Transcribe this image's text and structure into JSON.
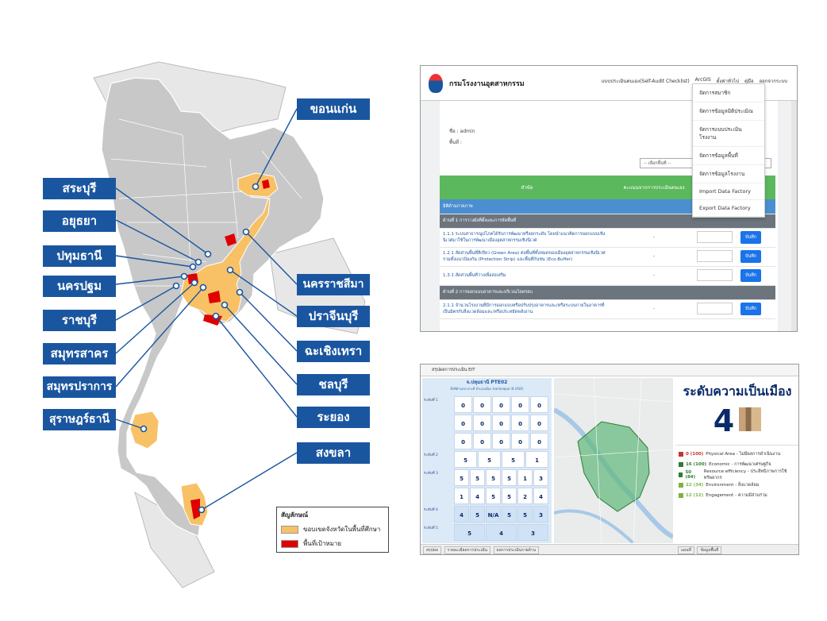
{
  "map": {
    "labels_left": [
      "สระบุรี",
      "อยุธยา",
      "ปทุมธานี",
      "นครปฐม",
      "ราชบุรี",
      "สมุทรสาคร",
      "สมุทรปราการ",
      "สุราษฎร์ธานี"
    ],
    "labels_right": [
      "ขอนแก่น",
      "นครราชสีมา",
      "ปราจีนบุรี",
      "ฉะเชิงเทรา",
      "ชลบุรี",
      "ระยอง",
      "สงขลา"
    ],
    "legend": {
      "title": "สัญลักษณ์",
      "items": [
        {
          "label": "ขอบเขตจังหวัดในพื้นที่ศึกษา",
          "color": "#f8c165"
        },
        {
          "label": "พื้นที่เป้าหมาย",
          "color": "#e00000"
        }
      ]
    },
    "colors": {
      "land": "#c8c8c8",
      "study": "#f8c165",
      "target": "#e00000",
      "label_bg": "#1a56a0",
      "line": "#1a56a0"
    }
  },
  "screen1": {
    "app_title": "กรมโรงงานอุตสาหกรรม",
    "nav": [
      "แบบประเมินตนเอง(Self-Audit Checklist)",
      "ArcGIS",
      "ตั้งค่าทั่วไป",
      "คู่มือ",
      "ออกจากระบบ"
    ],
    "dropdown": [
      "จัดการสมาชิก",
      "จัดการข้อมูลมิติประเมิณ",
      "จัดการแบบประเมินโรงงาน",
      "จัดการข้อมูลพื้นที่",
      "จัดการข้อมูลโรงงาน",
      "Import Data Factory",
      "Export Data Factory"
    ],
    "user_label": "ชื่อ : admin",
    "area_label": "พื้นที่ :",
    "select_placeholder": "-- เลือกพื้นที่ --",
    "table_head": [
      "หัวข้อ",
      "คะแนนจากการประเมินตนเอง"
    ],
    "section": "มิติด้านกายภาพ",
    "group1": "ด้านที่ 1 การวางผังที่ตั้งและการจัดพื้นที่",
    "rows": [
      {
        "text": "1.1.1 ระบบสาธารณูปโภคได้รับการพัฒนาหรือยกระดับ โดยนำแนวคิดการออกแบบเชิงนิเวศมาใช้ในการพัฒนาเมืองอุตสาหกรรมเชิงนิเวศ",
        "score": "-",
        "button": "บันทึก"
      },
      {
        "text": "1.2.1 สัดส่วนพื้นที่สีเขียว (Green Area) ต่อพื้นที่ทั้งหมดของเมืองอุตสาหกรรมเชิงนิเวศ รวมทั้งแนวป้องกัน (Protection Strip) และพื้นที่กันชน (Eco-Buffer)",
        "score": "-",
        "button": "บันทึก"
      },
      {
        "text": "1.3.1 สัดส่วนพื้นที่ว่างเพื่อส่งเสริม",
        "score": "-",
        "button": "บันทึก"
      }
    ],
    "group2": "ด้านที่ 2 การออกแบบอาคารและบริเวณโดยรอบ",
    "rows2": [
      {
        "text": "2.1.1 จำนวนโรงงานที่มีการออกแบบหรือปรับปรุงอาคารและ/หรือระบบภายในอาคารที่เป็นมิตรกับสิ่งแวดล้อมและ/หรือประหยัดพลังงาน",
        "score": "-",
        "button": "บันทึก"
      }
    ]
  },
  "screen2": {
    "app_title": "สรุปผลการประเมิน EIT",
    "grid_title": "จ.ปทุมธานี PTE02",
    "grid_subtitle": "ตั้งที่ตำบลบางกะดี อำเภอเมือง จังหวัดปทุมธานี (ASE)",
    "rows": [
      {
        "label": "ระดับที่ 1",
        "values": [
          "0",
          "0",
          "0",
          "0",
          "0"
        ]
      },
      {
        "label": "",
        "values": [
          "0",
          "0",
          "0",
          "0",
          "0"
        ]
      },
      {
        "label": "",
        "values": [
          "0",
          "0",
          "0",
          "0",
          "0"
        ]
      },
      {
        "label": "ระดับที่ 2",
        "values": [
          "5",
          "5",
          "5",
          "1"
        ]
      },
      {
        "label": "ระดับที่ 3",
        "values": [
          "5",
          "5",
          "5",
          "5",
          "1",
          "3"
        ]
      },
      {
        "label": "",
        "values": [
          "1",
          "4",
          "5",
          "5",
          "2",
          "4"
        ]
      },
      {
        "label": "ระดับที่ 4",
        "values": [
          "4",
          "5",
          "N/A",
          "5",
          "5",
          "3"
        ]
      },
      {
        "label": "ระดับที่ 5",
        "values": [
          "5",
          "4",
          "3"
        ]
      }
    ],
    "level_heading": "ระดับความเป็นเมือง",
    "level_value": "4",
    "items": [
      {
        "score": "0 (100)",
        "text": "Physical Area - ไม่มีผลการดำเนินงาน",
        "color": "#c0392b"
      },
      {
        "score": "16 (100)",
        "text": "Economic - การพัฒนาเศรษฐกิจ",
        "color": "#2e7d32"
      },
      {
        "score": "50 (84)",
        "text": "Resource efficiency - ประสิทธิภาพการใช้ทรัพยากร",
        "color": "#2e7d32"
      },
      {
        "score": "22 (34)",
        "text": "Environment - สิ่งแวดล้อม",
        "color": "#7cb342"
      },
      {
        "score": "12 (12)",
        "text": "Engagement - ความมีส่วนร่วม",
        "color": "#7cb342"
      }
    ],
    "tabs": [
      "สรุปผล",
      "รายละเอียดการประเมิน",
      "ผลการประเมินรายด้าน"
    ],
    "right_tabs": [
      "แผนที่",
      "ข้อมูลพื้นที่"
    ]
  }
}
